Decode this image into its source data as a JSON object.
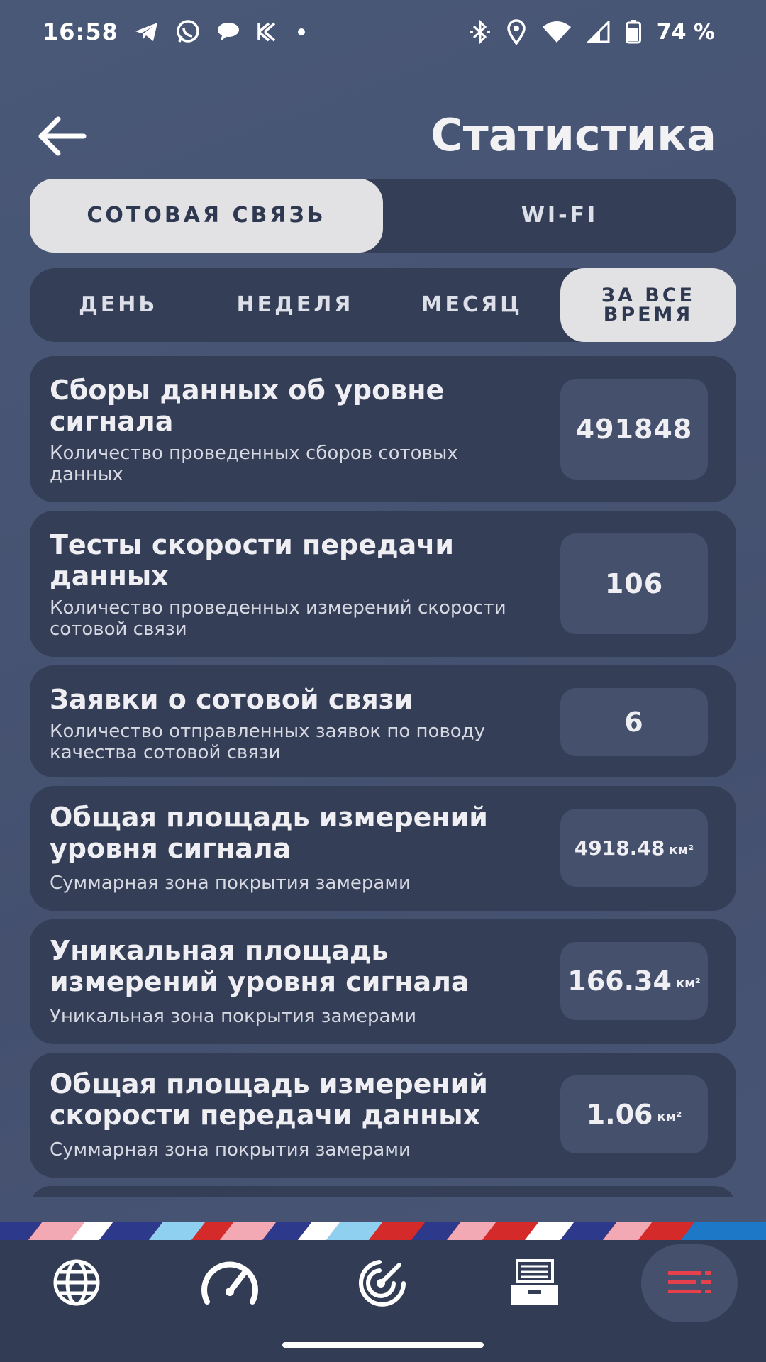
{
  "status_bar": {
    "time": "16:58",
    "battery_text": "74 %",
    "left_icons": [
      "telegram-icon",
      "whatsapp-icon",
      "chat-icon",
      "kaspersky-icon",
      "dot-icon"
    ],
    "right_icons": [
      "bluetooth-icon",
      "location-icon",
      "wifi-icon",
      "signal-icon",
      "battery-icon"
    ]
  },
  "header": {
    "title": "Статистика",
    "back_icon": "arrow-left-icon"
  },
  "network_tabs": [
    {
      "label": "СОТОВАЯ СВЯЗЬ",
      "active": true
    },
    {
      "label": "WI-FI",
      "active": false
    }
  ],
  "period_tabs": [
    {
      "label": "ДЕНЬ",
      "active": false
    },
    {
      "label": "НЕДЕЛЯ",
      "active": false
    },
    {
      "label": "МЕСЯЦ",
      "active": false
    },
    {
      "label": "ЗА ВСЕ ВРЕМЯ",
      "active": true
    }
  ],
  "cards": [
    {
      "title": "Сборы данных об уровне сигнала",
      "description": "Количество проведенных сборов сотовых данных",
      "value": "491848",
      "unit": ""
    },
    {
      "title": "Тесты скорости передачи данных",
      "description": "Количество проведенных измерений скорости сотовой связи",
      "value": "106",
      "unit": ""
    },
    {
      "title": "Заявки о сотовой связи",
      "description": "Количество отправленных заявок по поводу качества сотовой связи",
      "value": "6",
      "unit": ""
    },
    {
      "title": "Общая площадь измерений уровня сигнала",
      "description": "Суммарная зона покрытия замерами",
      "value": "4918.48",
      "unit": "км²"
    },
    {
      "title": "Уникальная площадь измерений уровня сигнала",
      "description": "Уникальная зона покрытия замерами",
      "value": "166.34",
      "unit": "км²"
    },
    {
      "title": "Общая площадь измерений скорости передачи данных",
      "description": "Суммарная зона покрытия замерами",
      "value": "1.06",
      "unit": "км²"
    }
  ],
  "bottom_nav": [
    {
      "icon": "globe-icon",
      "active": false
    },
    {
      "icon": "speedometer-icon",
      "active": false
    },
    {
      "icon": "radar-icon",
      "active": false
    },
    {
      "icon": "inbox-icon",
      "active": false
    },
    {
      "icon": "menu-icon",
      "active": true
    }
  ],
  "colors": {
    "background": "#46536f",
    "card": "#343e56",
    "value_box": "#44506c",
    "active_tab": "#e2e2e4",
    "accent_red": "#e5404b"
  }
}
